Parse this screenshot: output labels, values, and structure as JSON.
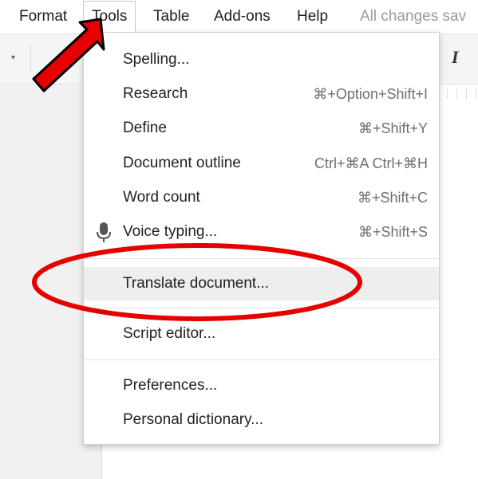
{
  "menubar": {
    "items": [
      {
        "label": "Format"
      },
      {
        "label": "Tools"
      },
      {
        "label": "Table"
      },
      {
        "label": "Add-ons"
      },
      {
        "label": "Help"
      }
    ],
    "save_status": "All changes sav"
  },
  "tools_menu": {
    "items": [
      {
        "label": "Spelling...",
        "shortcut": ""
      },
      {
        "label": "Research",
        "shortcut": "⌘+Option+Shift+I"
      },
      {
        "label": "Define",
        "shortcut": "⌘+Shift+Y"
      },
      {
        "label": "Document outline",
        "shortcut": "Ctrl+⌘A Ctrl+⌘H"
      },
      {
        "label": "Word count",
        "shortcut": "⌘+Shift+C"
      },
      {
        "label": "Voice typing...",
        "shortcut": "⌘+Shift+S",
        "icon": "microphone-icon"
      },
      {
        "label": "Translate document...",
        "shortcut": ""
      },
      {
        "label": "Script editor...",
        "shortcut": ""
      },
      {
        "label": "Preferences...",
        "shortcut": ""
      },
      {
        "label": "Personal dictionary...",
        "shortcut": ""
      }
    ],
    "highlighted": "Translate document..."
  },
  "toolbar": {
    "italic_label": "I"
  },
  "annotations": {
    "arrow_color": "#e60000",
    "ellipse_color": "#e60000"
  }
}
